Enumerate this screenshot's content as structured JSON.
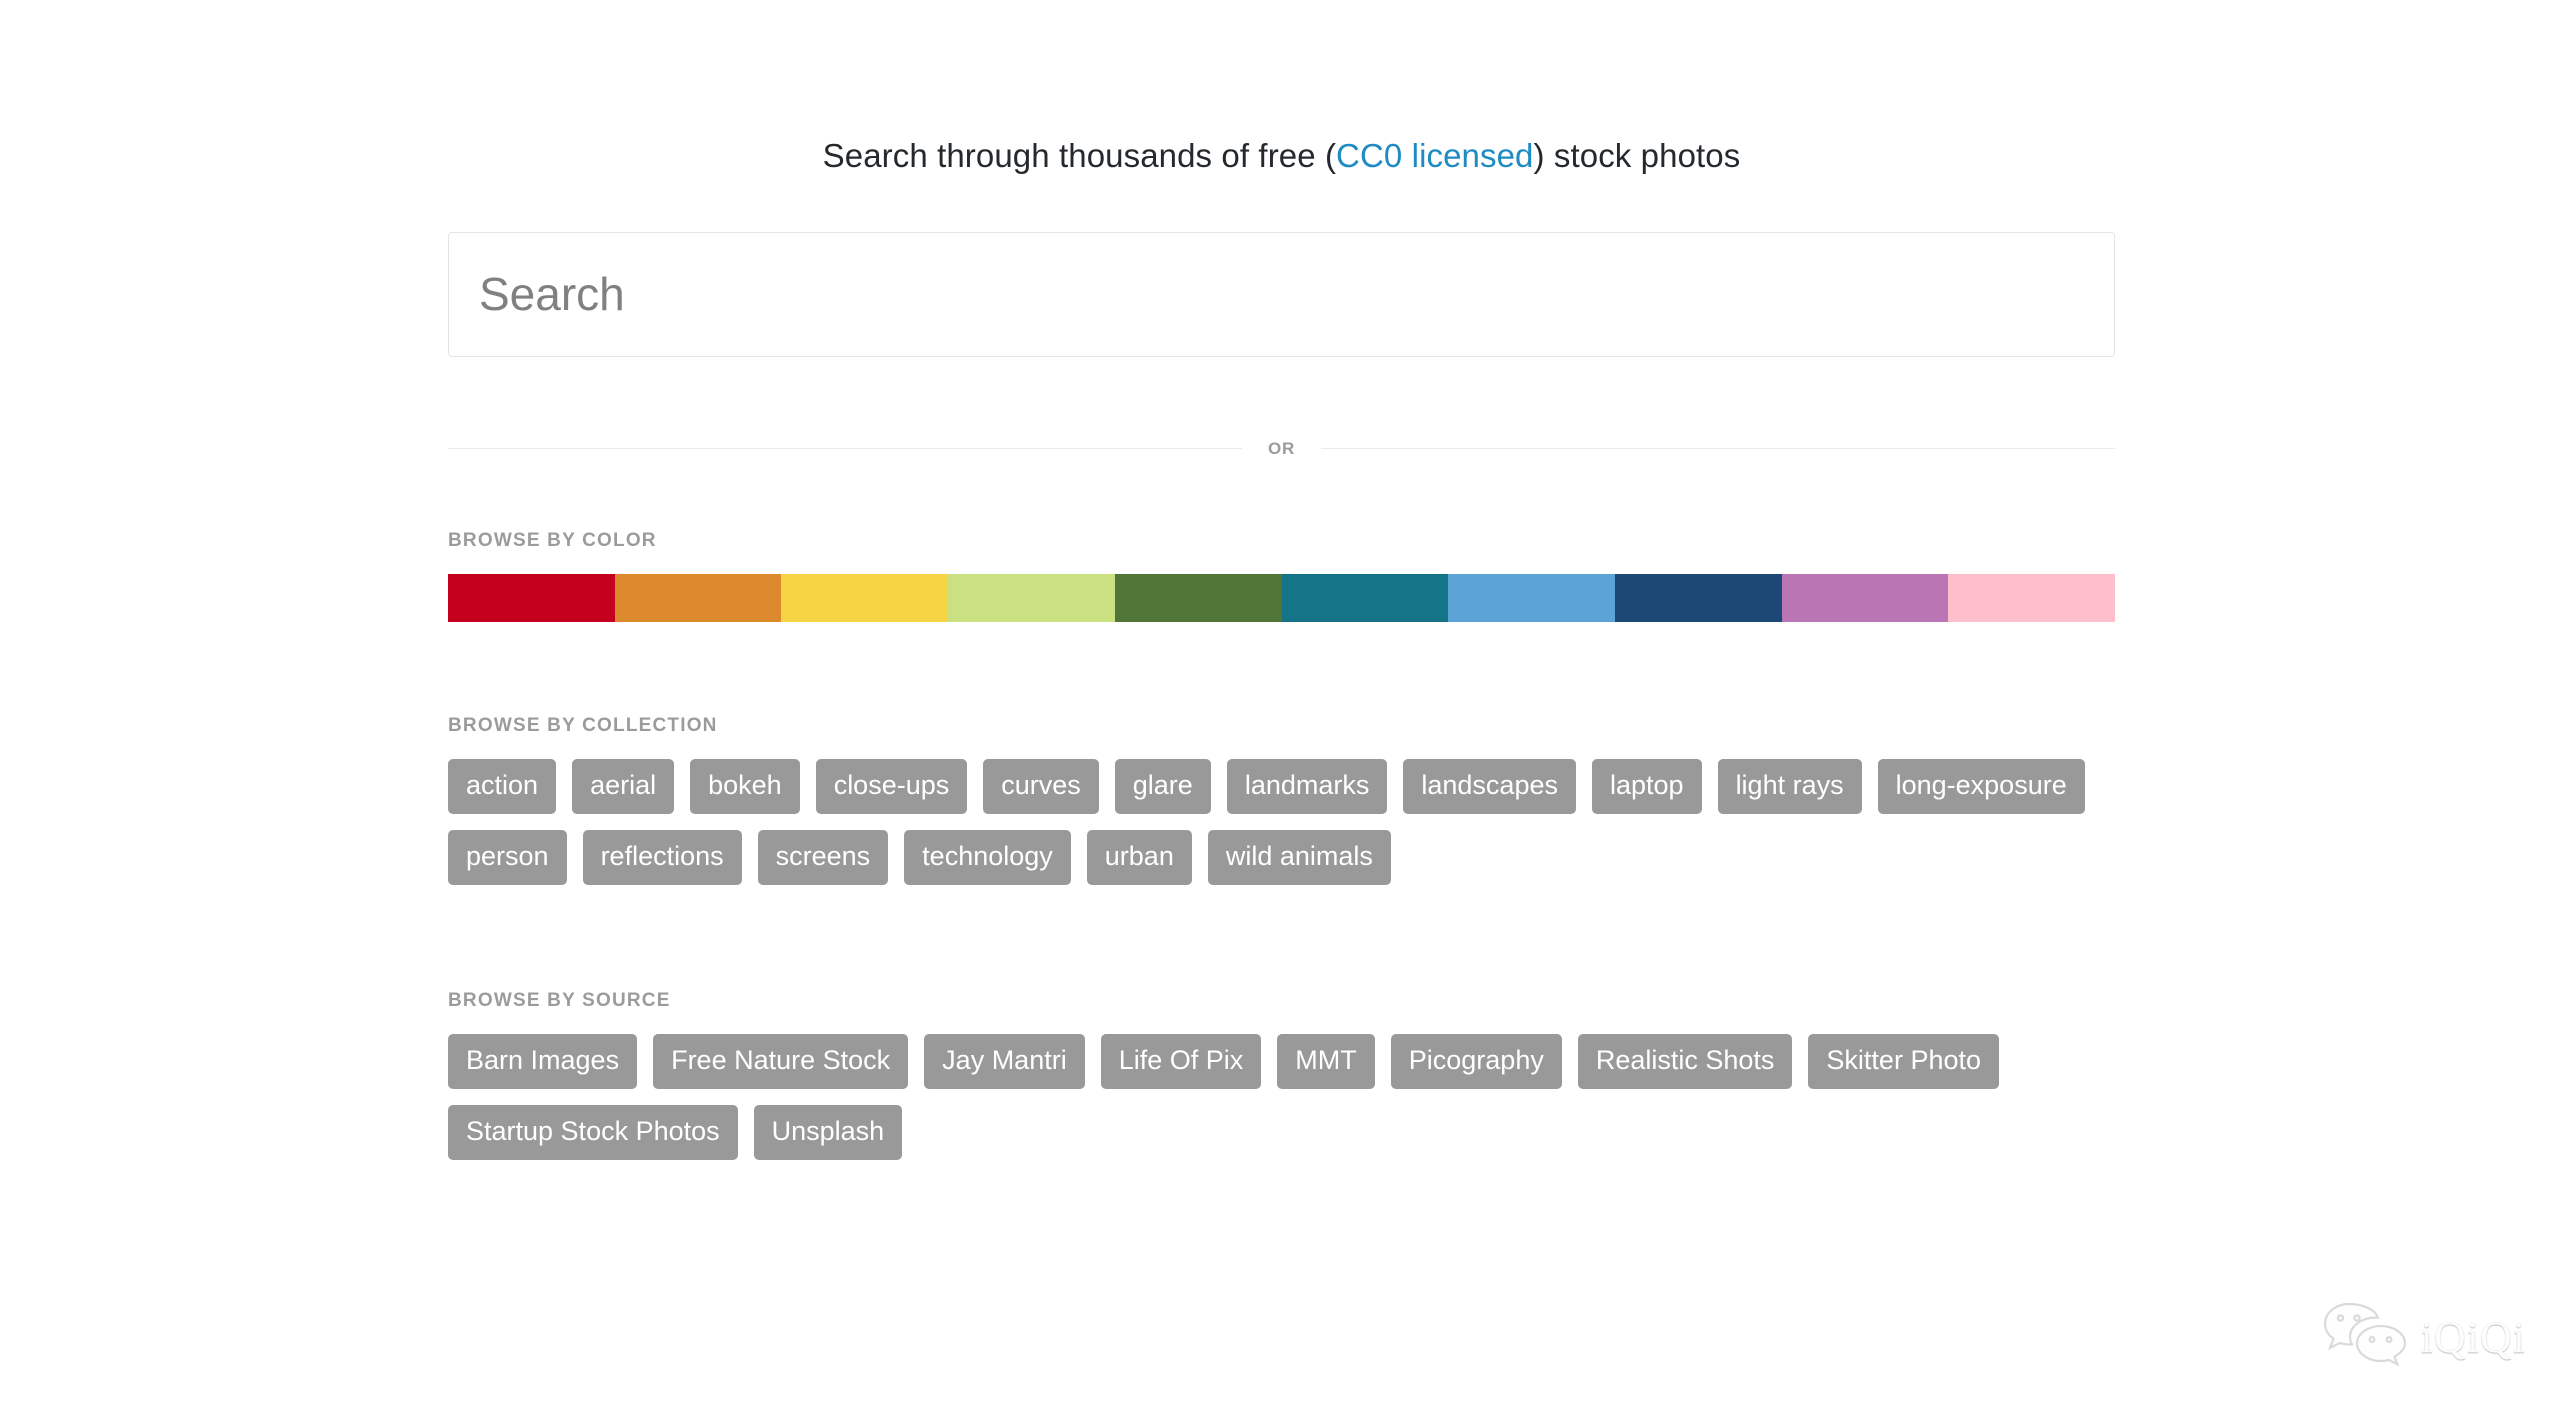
{
  "headline": {
    "prefix": "Search through thousands of free (",
    "link_text": "CC0 licensed",
    "suffix": ") stock photos"
  },
  "search": {
    "placeholder": "Search",
    "value": ""
  },
  "divider": {
    "label": "OR"
  },
  "colors_section": {
    "label": "BROWSE BY COLOR",
    "swatches": [
      {
        "name": "red",
        "hex": "#C4001E"
      },
      {
        "name": "orange",
        "hex": "#DD8A2E"
      },
      {
        "name": "yellow",
        "hex": "#F5D543"
      },
      {
        "name": "light-green",
        "hex": "#CBE181"
      },
      {
        "name": "dark-green",
        "hex": "#507536"
      },
      {
        "name": "teal",
        "hex": "#157488"
      },
      {
        "name": "light-blue",
        "hex": "#5CA4D8"
      },
      {
        "name": "navy",
        "hex": "#1C4876"
      },
      {
        "name": "purple",
        "hex": "#BA76B4"
      },
      {
        "name": "pink",
        "hex": "#FFBECB"
      }
    ]
  },
  "collection_section": {
    "label": "BROWSE BY COLLECTION",
    "tags": [
      "action",
      "aerial",
      "bokeh",
      "close-ups",
      "curves",
      "glare",
      "landmarks",
      "landscapes",
      "laptop",
      "light rays",
      "long-exposure",
      "person",
      "reflections",
      "screens",
      "technology",
      "urban",
      "wild animals"
    ]
  },
  "source_section": {
    "label": "BROWSE BY SOURCE",
    "tags": [
      "Barn Images",
      "Free Nature Stock",
      "Jay Mantri",
      "Life Of Pix",
      "MMT",
      "Picography",
      "Realistic Shots",
      "Skitter Photo",
      "Startup Stock Photos",
      "Unsplash"
    ]
  },
  "watermark": {
    "icon": "wechat-icon",
    "text": "iQiQi"
  }
}
